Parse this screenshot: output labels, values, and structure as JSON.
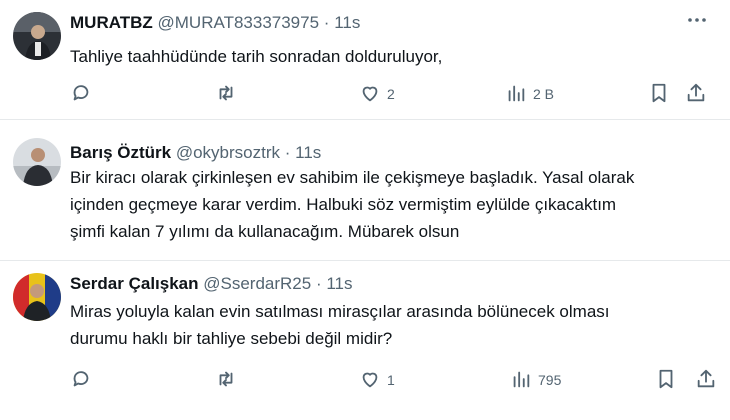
{
  "tweets": [
    {
      "name": "MURATBZ",
      "handle": "@MURAT833373975",
      "separator": "·",
      "time": "11s",
      "text": [
        "Tahliye taahhüdünde tarih sonradan dolduruluyor,"
      ],
      "stats": {
        "reply": "",
        "retweet": "",
        "like": "2",
        "views": "2 B"
      }
    },
    {
      "name": "Barış Öztürk",
      "handle": "@okybrsoztrk",
      "separator": "·",
      "time": "11s",
      "text": [
        "Bir kiracı olarak çirkinleşen ev sahibim ile çekişmeye başladık. Yasal olarak",
        "içinden geçmeye karar verdim. Halbuki söz vermiştim eylülde çıkacaktım",
        "şimfi kalan 7 yılımı da kullanacağım. Mübarek olsun"
      ]
    },
    {
      "name": "Serdar Çalışkan",
      "handle": "@SserdarR25",
      "separator": "·",
      "time": "11s",
      "text": [
        "Miras yoluyla kalan evin satılması mirasçılar arasında bölünecek olması",
        "durumu haklı bir tahliye sebebi değil midir?"
      ],
      "stats": {
        "reply": "",
        "retweet": "",
        "like": "1",
        "views": "795"
      }
    }
  ],
  "colors": {
    "text": "#0f1419",
    "secondary": "#536471",
    "divider": "#e6e9eb"
  },
  "icons": [
    "more-icon",
    "reply-icon",
    "retweet-icon",
    "like-icon",
    "views-icon",
    "bookmark-icon",
    "share-icon"
  ]
}
